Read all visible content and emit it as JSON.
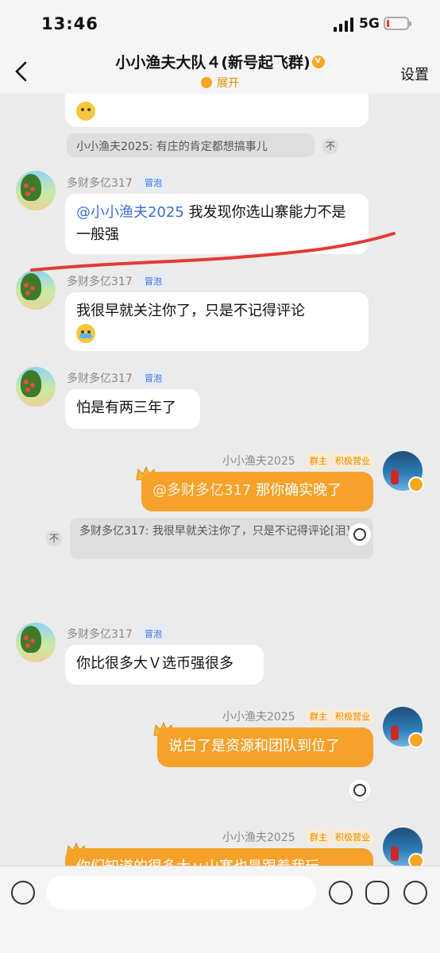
{
  "status": {
    "time": "13:46",
    "network": "5G"
  },
  "nav": {
    "title": "小小渔夫大队４(新号起飞群)",
    "expand": "展开",
    "settings": "设置"
  },
  "messages": {
    "m0_quote": "小小渔夫2025: 有庄的肯定都想搞事儿",
    "m0_quote_close": "不",
    "m1": {
      "sender": "多财多亿317",
      "tag": "冒泡",
      "mention": "@小小渔夫2025",
      "text": " 我发现你选山寨能力不是一般强"
    },
    "m2": {
      "sender": "多财多亿317",
      "tag": "冒泡",
      "text": "我很早就关注你了，只是不记得评论"
    },
    "m3": {
      "sender": "多财多亿317",
      "tag": "冒泡",
      "text": "怕是有两三年了"
    },
    "m4": {
      "sender": "小小渔夫2025",
      "tag_owner": "群主",
      "tag_active": "积极营业",
      "mention": "@多财多亿317",
      "text": " 那你确实晚了",
      "quote": "多财多亿317: 我很早就关注你了，只是不记得评论[泪]",
      "quote_close": "不"
    },
    "m5": {
      "sender": "多财多亿317",
      "tag": "冒泡",
      "text": "你比很多大Ｖ选币强很多"
    },
    "m6": {
      "sender": "小小渔夫2025",
      "tag_owner": "群主",
      "tag_active": "积极营业",
      "text": "说白了是资源和团队到位了"
    },
    "m7": {
      "sender": "小小渔夫2025",
      "tag_owner": "群主",
      "tag_active": "积极营业",
      "text": "你们知道的很多大ｖ山寨也是跟着我玩"
    }
  },
  "input": {
    "placeholder": ""
  },
  "colors": {
    "accent": "#f6a12a",
    "mention": "#3b6fd3",
    "annotation": "#e53935"
  }
}
